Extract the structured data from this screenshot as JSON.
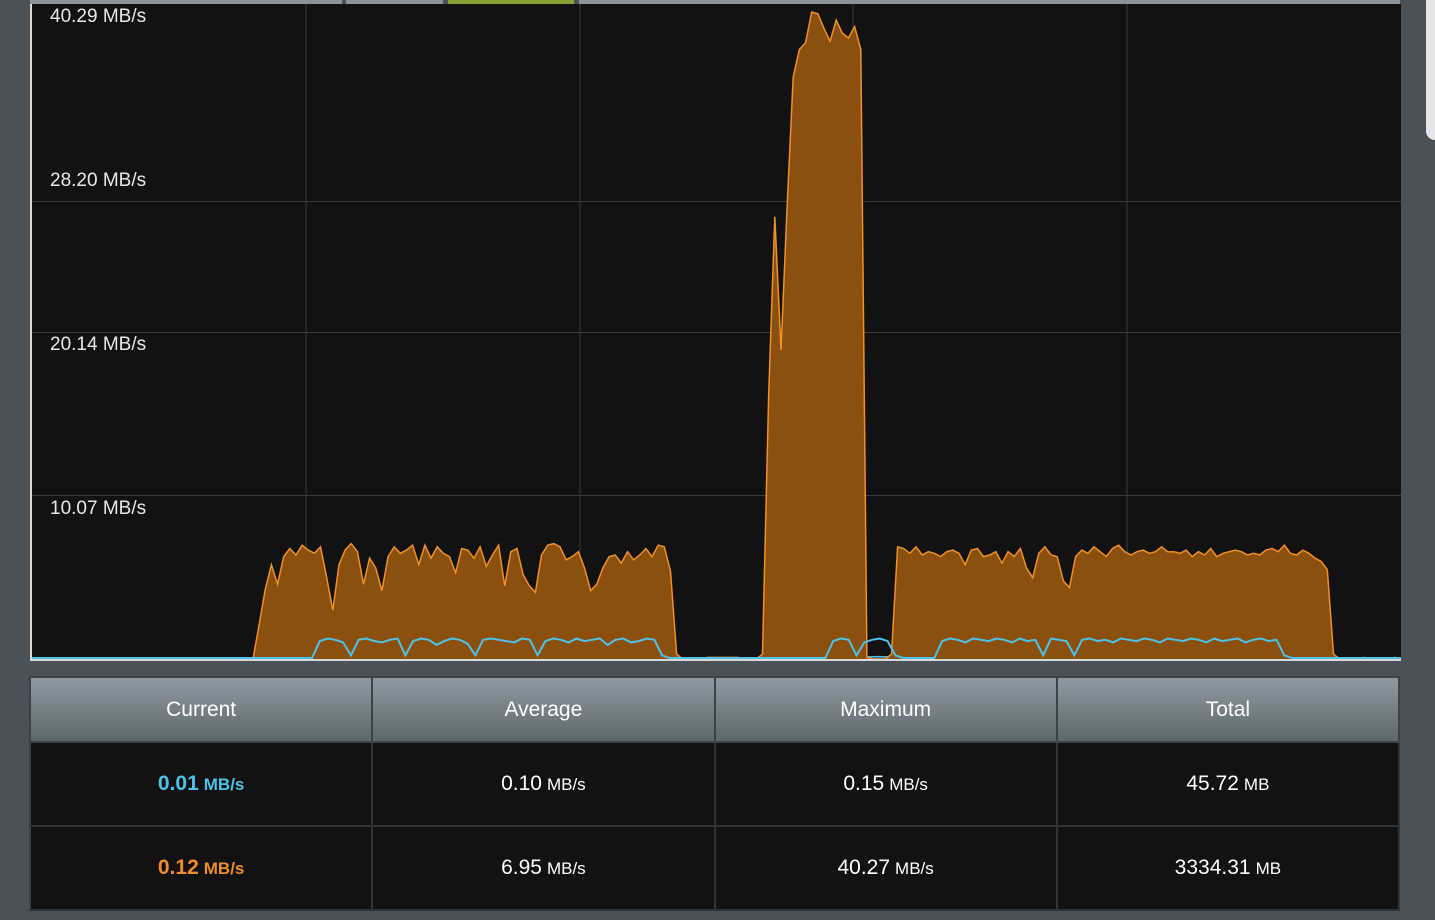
{
  "chart_data": {
    "type": "area",
    "y_unit": "MB/s",
    "y_ticks": [
      "40.29 MB/s",
      "28.20 MB/s",
      "20.14 MB/s",
      "10.07 MB/s"
    ],
    "ylim": [
      0,
      40.29
    ],
    "series": [
      {
        "color": "#4fc2e8",
        "fill": "#0d3a4a",
        "values": [
          0,
          0,
          0,
          0,
          0,
          0,
          0,
          0,
          0,
          0,
          0,
          0,
          0,
          0,
          0,
          0,
          0,
          0,
          0,
          0,
          0,
          0,
          0,
          0,
          0,
          0,
          0,
          0,
          0,
          0,
          0,
          0,
          0,
          0,
          0,
          0,
          0,
          0.13,
          0.15,
          0.14,
          0.12,
          0.02,
          0.14,
          0.15,
          0.13,
          0.12,
          0.14,
          0.15,
          0.02,
          0.13,
          0.15,
          0.14,
          0.1,
          0.13,
          0.15,
          0.14,
          0.11,
          0.02,
          0.14,
          0.15,
          0.14,
          0.13,
          0.12,
          0.15,
          0.14,
          0.02,
          0.13,
          0.15,
          0.14,
          0.12,
          0.15,
          0.13,
          0.14,
          0.15,
          0.1,
          0.14,
          0.15,
          0.12,
          0.13,
          0.15,
          0.14,
          0.02,
          0,
          0,
          0,
          0,
          0,
          0,
          0,
          0,
          0,
          0,
          0,
          0,
          0,
          0,
          0,
          0,
          0,
          0,
          0,
          0,
          0,
          0.13,
          0.15,
          0.14,
          0.02,
          0.12,
          0.14,
          0.15,
          0.13,
          0.02,
          0,
          0,
          0,
          0,
          0,
          0.13,
          0.15,
          0.14,
          0.12,
          0.15,
          0.14,
          0.13,
          0.15,
          0.14,
          0.12,
          0.15,
          0.13,
          0.14,
          0.02,
          0.15,
          0.14,
          0.13,
          0.02,
          0.14,
          0.15,
          0.13,
          0.14,
          0.12,
          0.15,
          0.14,
          0.13,
          0.15,
          0.14,
          0.12,
          0.15,
          0.14,
          0.13,
          0.15,
          0.14,
          0.12,
          0.15,
          0.13,
          0.14,
          0.15,
          0.12,
          0.14,
          0.15,
          0.13,
          0.14,
          0.02,
          0,
          0,
          0,
          0,
          0,
          0,
          0,
          0,
          0,
          0,
          0,
          0,
          0,
          0,
          0
        ]
      },
      {
        "color": "#f0902c",
        "fill": "#8b500e",
        "values": [
          0,
          0,
          0,
          0,
          0,
          0,
          0,
          0,
          0,
          0,
          0,
          0,
          0,
          0,
          0,
          0,
          0,
          0,
          0,
          0,
          0,
          0,
          0,
          0,
          0,
          0,
          0,
          0,
          0,
          0,
          0,
          0,
          0,
          0,
          0,
          0,
          0,
          2.1,
          4.3,
          5.8,
          4.6,
          6.3,
          6.8,
          6.4,
          7.0,
          6.7,
          6.5,
          6.9,
          5.0,
          3.0,
          5.8,
          6.7,
          7.1,
          6.6,
          4.6,
          6.2,
          5.6,
          4.2,
          6.3,
          6.9,
          6.5,
          6.7,
          7.0,
          5.8,
          7.0,
          6.2,
          6.9,
          6.5,
          6.3,
          5.3,
          6.8,
          6.7,
          6.2,
          6.9,
          5.7,
          6.4,
          7.0,
          4.5,
          6.6,
          6.8,
          5.2,
          4.5,
          4.1,
          6.4,
          7.0,
          7.1,
          6.9,
          6.1,
          6.3,
          6.6,
          5.6,
          4.2,
          4.6,
          5.6,
          6.3,
          6.4,
          5.9,
          6.6,
          6.1,
          6.4,
          6.8,
          6.3,
          7.0,
          6.9,
          5.4,
          0.3,
          0,
          0,
          0,
          0,
          0.1,
          0.1,
          0.1,
          0.1,
          0.1,
          0.1,
          0,
          0,
          0,
          0.3,
          16.3,
          27.2,
          19.0,
          27.8,
          35.8,
          37.5,
          37.9,
          39.8,
          39.7,
          38.8,
          38.0,
          39.3,
          38.5,
          38.2,
          38.9,
          37.5,
          0.1,
          0,
          0,
          0,
          0.3,
          6.9,
          6.8,
          6.5,
          6.9,
          6.4,
          6.6,
          6.5,
          6.3,
          6.6,
          6.7,
          6.5,
          5.8,
          6.7,
          6.8,
          6.3,
          6.4,
          6.6,
          5.9,
          6.6,
          6.3,
          6.8,
          5.6,
          5.0,
          6.5,
          6.9,
          6.4,
          6.3,
          4.8,
          4.4,
          6.3,
          6.7,
          6.5,
          6.9,
          6.6,
          6.3,
          6.8,
          7.0,
          6.6,
          6.4,
          6.6,
          6.7,
          6.5,
          6.6,
          6.9,
          6.6,
          6.6,
          6.5,
          6.7,
          6.3,
          6.6,
          6.4,
          6.8,
          6.3,
          6.5,
          6.6,
          6.7,
          6.6,
          6.4,
          6.5,
          6.4,
          6.7,
          6.8,
          6.6,
          7.0,
          6.5,
          6.4,
          6.7,
          6.5,
          6.2,
          6.0,
          5.5,
          0.3,
          0,
          0,
          0,
          0,
          0.1,
          0,
          0,
          0,
          0,
          0.1,
          0
        ]
      }
    ]
  },
  "table": {
    "headers": {
      "current": "Current",
      "average": "Average",
      "maximum": "Maximum",
      "total": "Total"
    },
    "rx": {
      "current": "0.01",
      "current_unit": "MB/s",
      "average": "0.10",
      "average_unit": "MB/s",
      "maximum": "0.15",
      "maximum_unit": "MB/s",
      "total": "45.72",
      "total_unit": "MB"
    },
    "tx": {
      "current": "0.12",
      "current_unit": "MB/s",
      "average": "6.95",
      "average_unit": "MB/s",
      "maximum": "40.27",
      "maximum_unit": "MB/s",
      "total": "3334.31",
      "total_unit": "MB"
    }
  },
  "colors": {
    "rx": "#4fc2e8",
    "tx": "#ee8d2d",
    "active_tab": "#8aa233"
  }
}
